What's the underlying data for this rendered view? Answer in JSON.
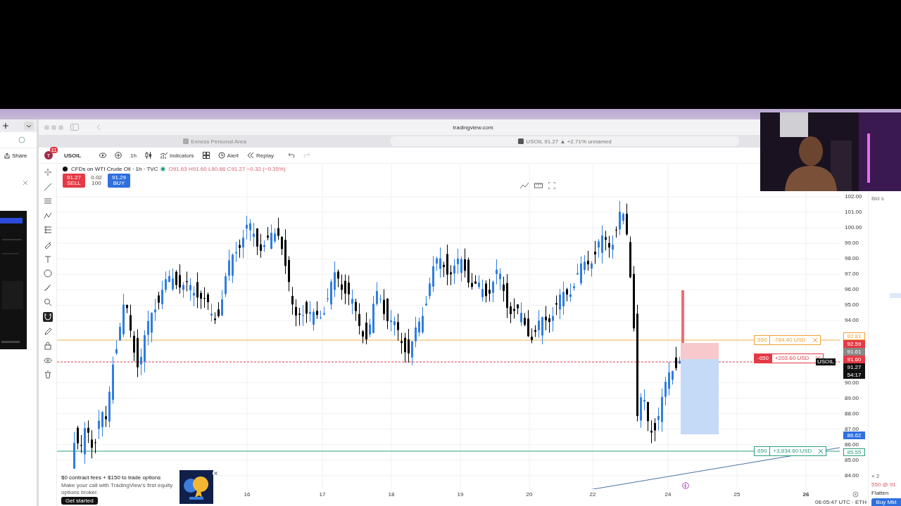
{
  "side_window": {
    "share": "Share"
  },
  "browser": {
    "url": "tradingview.com",
    "tabs": [
      {
        "label": "Exness Personal Area",
        "selected": false
      },
      {
        "label": "USOIL 91.27 ▲ +2.71% unnamed",
        "selected": true
      }
    ]
  },
  "toolbar": {
    "avatar": "T",
    "badge": "11",
    "symbol": "USOIL",
    "interval": "1h",
    "indicators": "Indicators",
    "alert": "Alert",
    "replay": "Replay"
  },
  "tools": [
    {
      "kind": "crosshair",
      "selected": false
    },
    {
      "kind": "trend",
      "selected": false
    },
    {
      "kind": "fib",
      "selected": false
    },
    {
      "kind": "pattern",
      "selected": false
    },
    {
      "kind": "lines",
      "selected": false
    },
    {
      "kind": "brush",
      "selected": false
    },
    {
      "kind": "text",
      "selected": false
    },
    {
      "kind": "smile",
      "selected": false
    },
    {
      "kind": "ruler",
      "selected": false
    },
    {
      "kind": "zoom",
      "selected": false
    },
    {
      "kind": "magnet",
      "selected": true
    },
    {
      "kind": "pencil",
      "selected": false
    },
    {
      "kind": "lock",
      "selected": false
    },
    {
      "kind": "eye",
      "selected": false
    },
    {
      "kind": "trash",
      "selected": false
    }
  ],
  "legend": {
    "title": "CFDs on WTI Crude Oil · 1h · TVC",
    "ohlc": "O91.63 H91.60 L90.86 C91.27 −0.32 (−0.35%)",
    "sell_price": "91.27",
    "sell_label": "SELL",
    "spread": "0.02",
    "quantity": "100",
    "buy_price": "91.29",
    "buy_label": "BUY"
  },
  "price_axis": [
    "102.00",
    "101.00",
    "100.00",
    "99.00",
    "98.00",
    "97.00",
    "96.00",
    "95.00",
    "94.00",
    "90.00",
    "89.00",
    "88.00",
    "87.00",
    "86.00",
    "85.00",
    "84.00"
  ],
  "time_axis": [
    {
      "label": "16",
      "bold": false
    },
    {
      "label": "17",
      "bold": false
    },
    {
      "label": "18",
      "bold": false
    },
    {
      "label": "19",
      "bold": false
    },
    {
      "label": "20",
      "bold": false
    },
    {
      "label": "22",
      "bold": false
    },
    {
      "label": "24",
      "bold": false
    },
    {
      "label": "25",
      "bold": false
    },
    {
      "label": "26",
      "bold": true
    }
  ],
  "orders": [
    {
      "quantity": "550",
      "pnl": "-784.40 USD",
      "color": "#f0a030",
      "filled": false
    },
    {
      "quantity": "-650",
      "pnl": "+203.60 USD",
      "color": "#e53945",
      "filled": true
    },
    {
      "quantity": "650",
      "pnl": "+3,834.60 USD",
      "color": "#2a9d7f",
      "filled": false
    }
  ],
  "price_tags": [
    {
      "text": "92.81",
      "color": "#f0a030",
      "kind": "outline"
    },
    {
      "text": "92.59",
      "color": "#e53945",
      "kind": "solid"
    },
    {
      "text": "91.61",
      "color": "#888888",
      "kind": "solid"
    },
    {
      "text": "91.60",
      "color": "#e53945",
      "kind": "solid"
    },
    {
      "text": "91.27",
      "color": "#111111",
      "kind": "solid"
    },
    {
      "text": "54:17",
      "color": "#111111",
      "kind": "solid"
    }
  ],
  "symbol_tag": "USOIL",
  "lower_tags": [
    {
      "text": "86.62",
      "color": "#2f6fe0",
      "kind": "solid"
    },
    {
      "text": "85.55",
      "color": "#2a9d7f",
      "kind": "outline"
    }
  ],
  "ad": {
    "title": "$0 contract fees + $150 to trade options",
    "body": "Make your call with TradingView's first equity options broker.",
    "button": "Get started"
  },
  "trade_panel": {
    "header": "Bid s",
    "count": "× 2",
    "order": "550 @ 91",
    "flatten": "Flatten",
    "buy": "Buy Mkt"
  },
  "clock": "06:05:47 UTC · ETH"
}
